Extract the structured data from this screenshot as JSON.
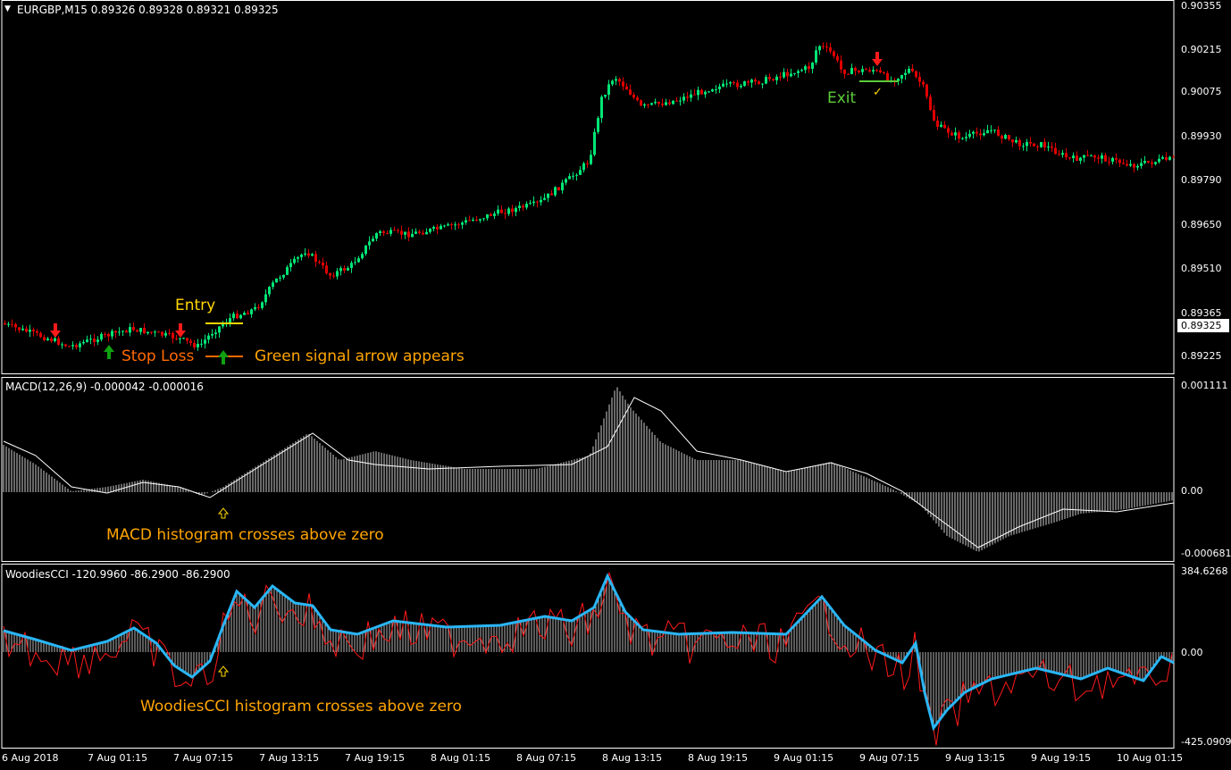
{
  "main": {
    "header": "EURGBP,M15  0.89326 0.89328 0.89321 0.89325",
    "price_levels": [
      "0.90355",
      "0.90215",
      "0.90075",
      "0.89930",
      "0.89790",
      "0.89650",
      "0.89510",
      "0.89365",
      "0.89225"
    ],
    "current_price": "0.89325"
  },
  "macd": {
    "header": "MACD(12,26,9) -0.000042 -0.000016",
    "levels": [
      "0.001111",
      "0.00",
      "-0.000681"
    ]
  },
  "cci": {
    "header": "WoodiesCCI -120.9960 -86.2900 -86.2900",
    "levels": [
      "384.6268",
      "0.00",
      "-425.0909"
    ]
  },
  "time_axis": [
    "6 Aug 2018",
    "7 Aug 01:15",
    "7 Aug 07:15",
    "7 Aug 13:15",
    "7 Aug 19:15",
    "8 Aug 01:15",
    "8 Aug 07:15",
    "8 Aug 13:15",
    "8 Aug 19:15",
    "9 Aug 01:15",
    "9 Aug 07:15",
    "9 Aug 13:15",
    "9 Aug 19:15",
    "10 Aug 01:15"
  ],
  "annotations": {
    "entry": "Entry",
    "stop_loss": "Stop Loss",
    "green_signal": "Green signal arrow appears",
    "exit": "Exit",
    "macd_note": "MACD histogram crosses above zero",
    "cci_note": "WoodiesCCI histogram crosses above zero"
  },
  "colors": {
    "bull": "#00e676",
    "bear": "#e00000",
    "grid_border": "#ffffff",
    "cci_line": "#29b6f6",
    "cci_trend": "#ff1a1a",
    "annotation_yellow": "#ffd700",
    "annotation_orange": "#ff6a00",
    "exit_green": "#5ccc3a"
  },
  "icons": [
    "sell-arrow-icon",
    "buy-arrow-icon",
    "check-icon",
    "up-outline-arrow-icon"
  ]
}
